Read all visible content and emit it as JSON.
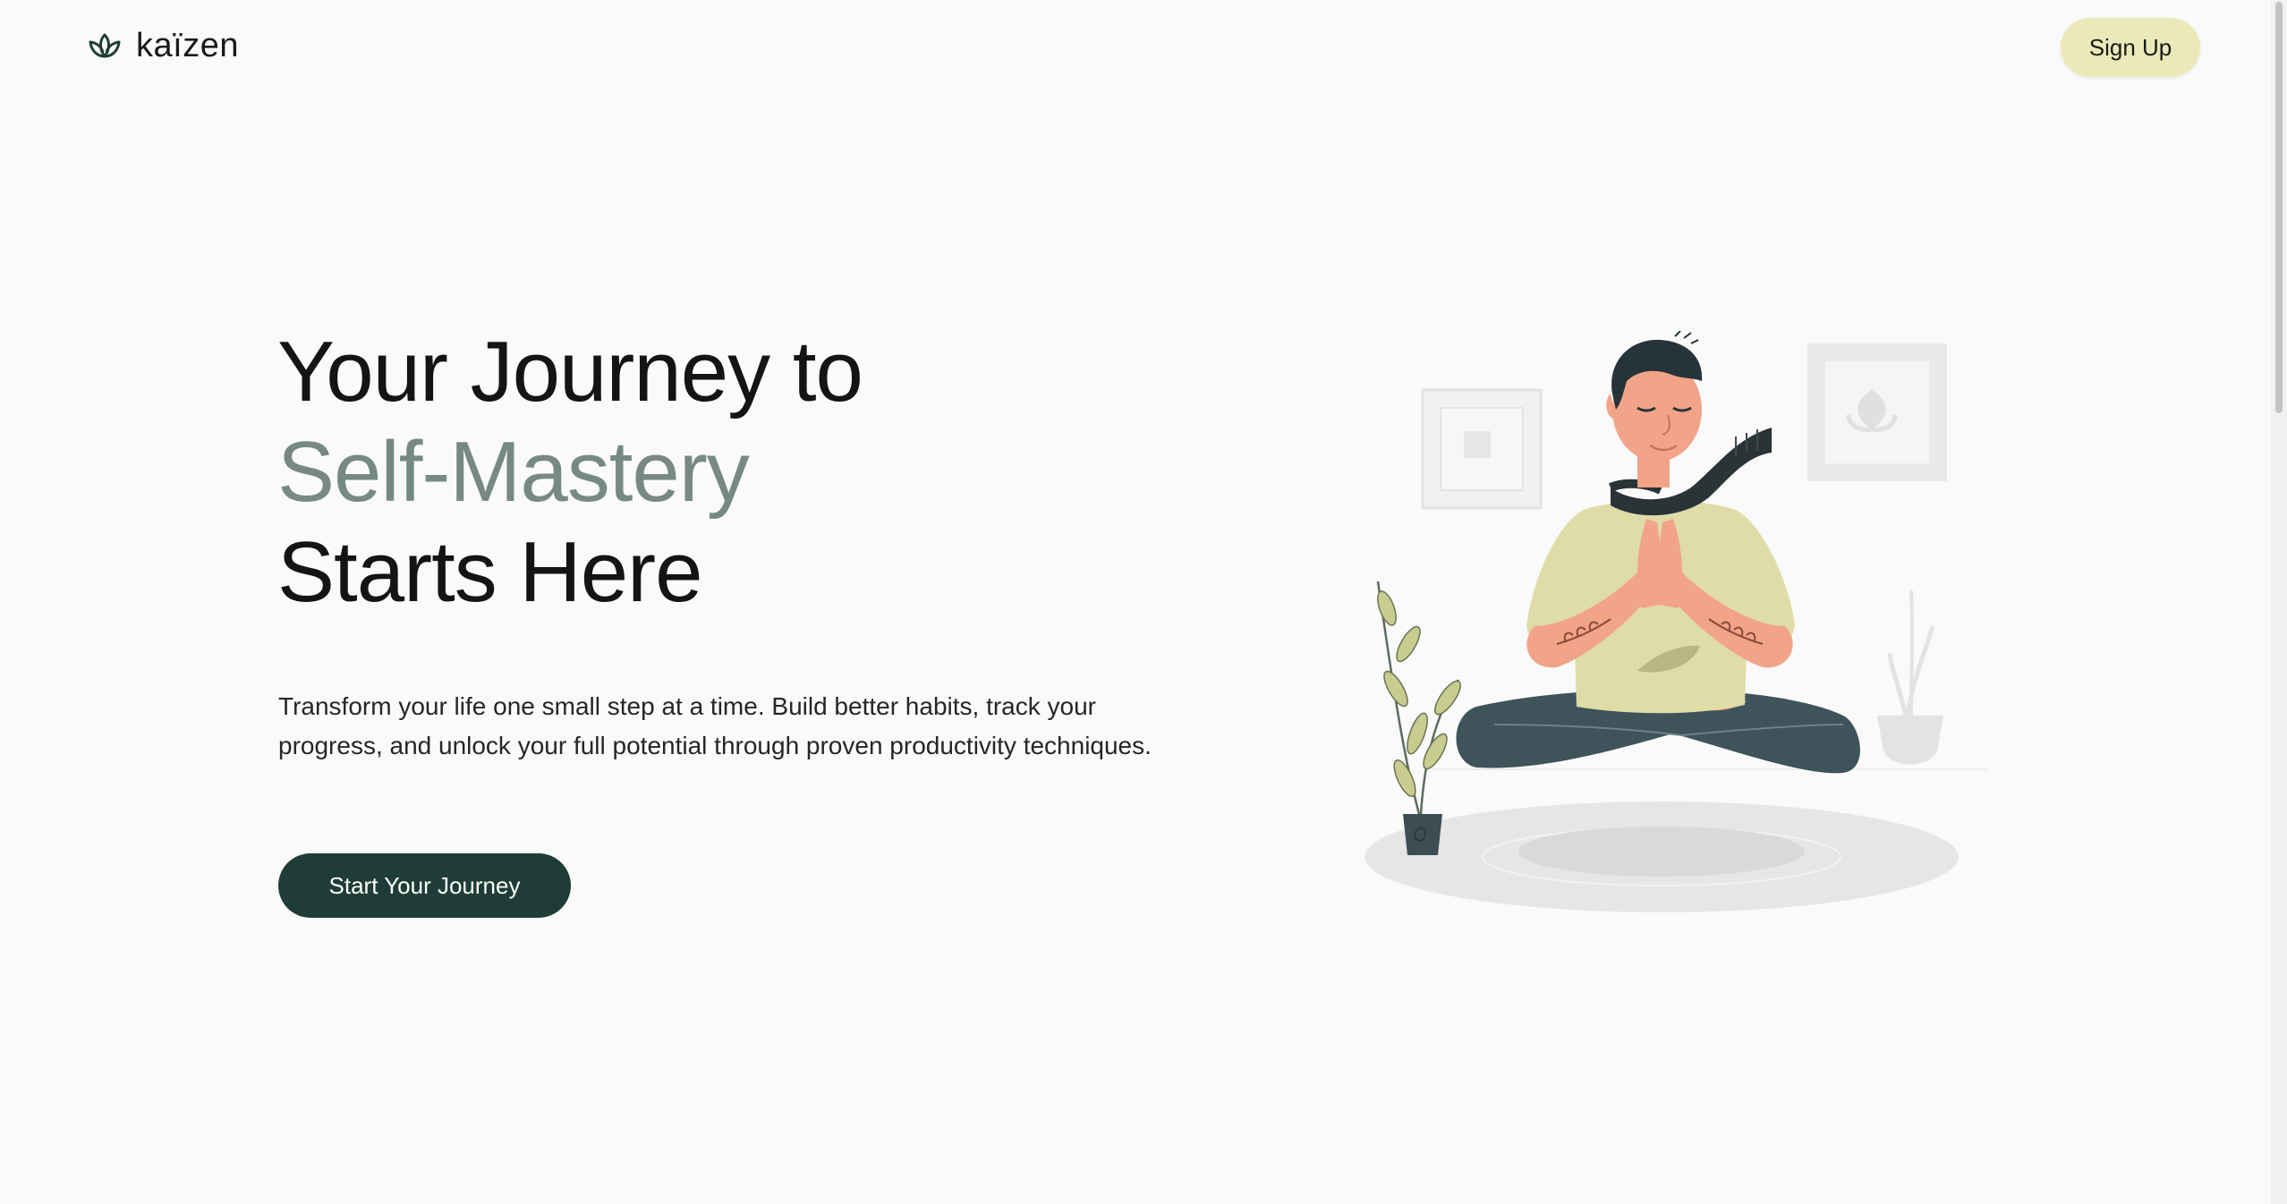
{
  "brand": {
    "name": "kaïzen"
  },
  "header": {
    "signup_label": "Sign Up"
  },
  "hero": {
    "headline_line1": "Your Journey to",
    "headline_line2": "Self-Mastery",
    "headline_line3": "Starts Here",
    "description": "Transform your life one small step at a time. Build better habits, track your progress, and unlock your full potential through proven productivity techniques.",
    "cta_label": "Start Your Journey"
  },
  "colors": {
    "background": "#fafafa",
    "accent_text": "#768a83",
    "primary_button": "#1f3d36",
    "signup_button": "#ebe9b9"
  },
  "icons": [
    "lotus-logo-icon"
  ],
  "illustration": {
    "subject": "meditation-illustration"
  }
}
